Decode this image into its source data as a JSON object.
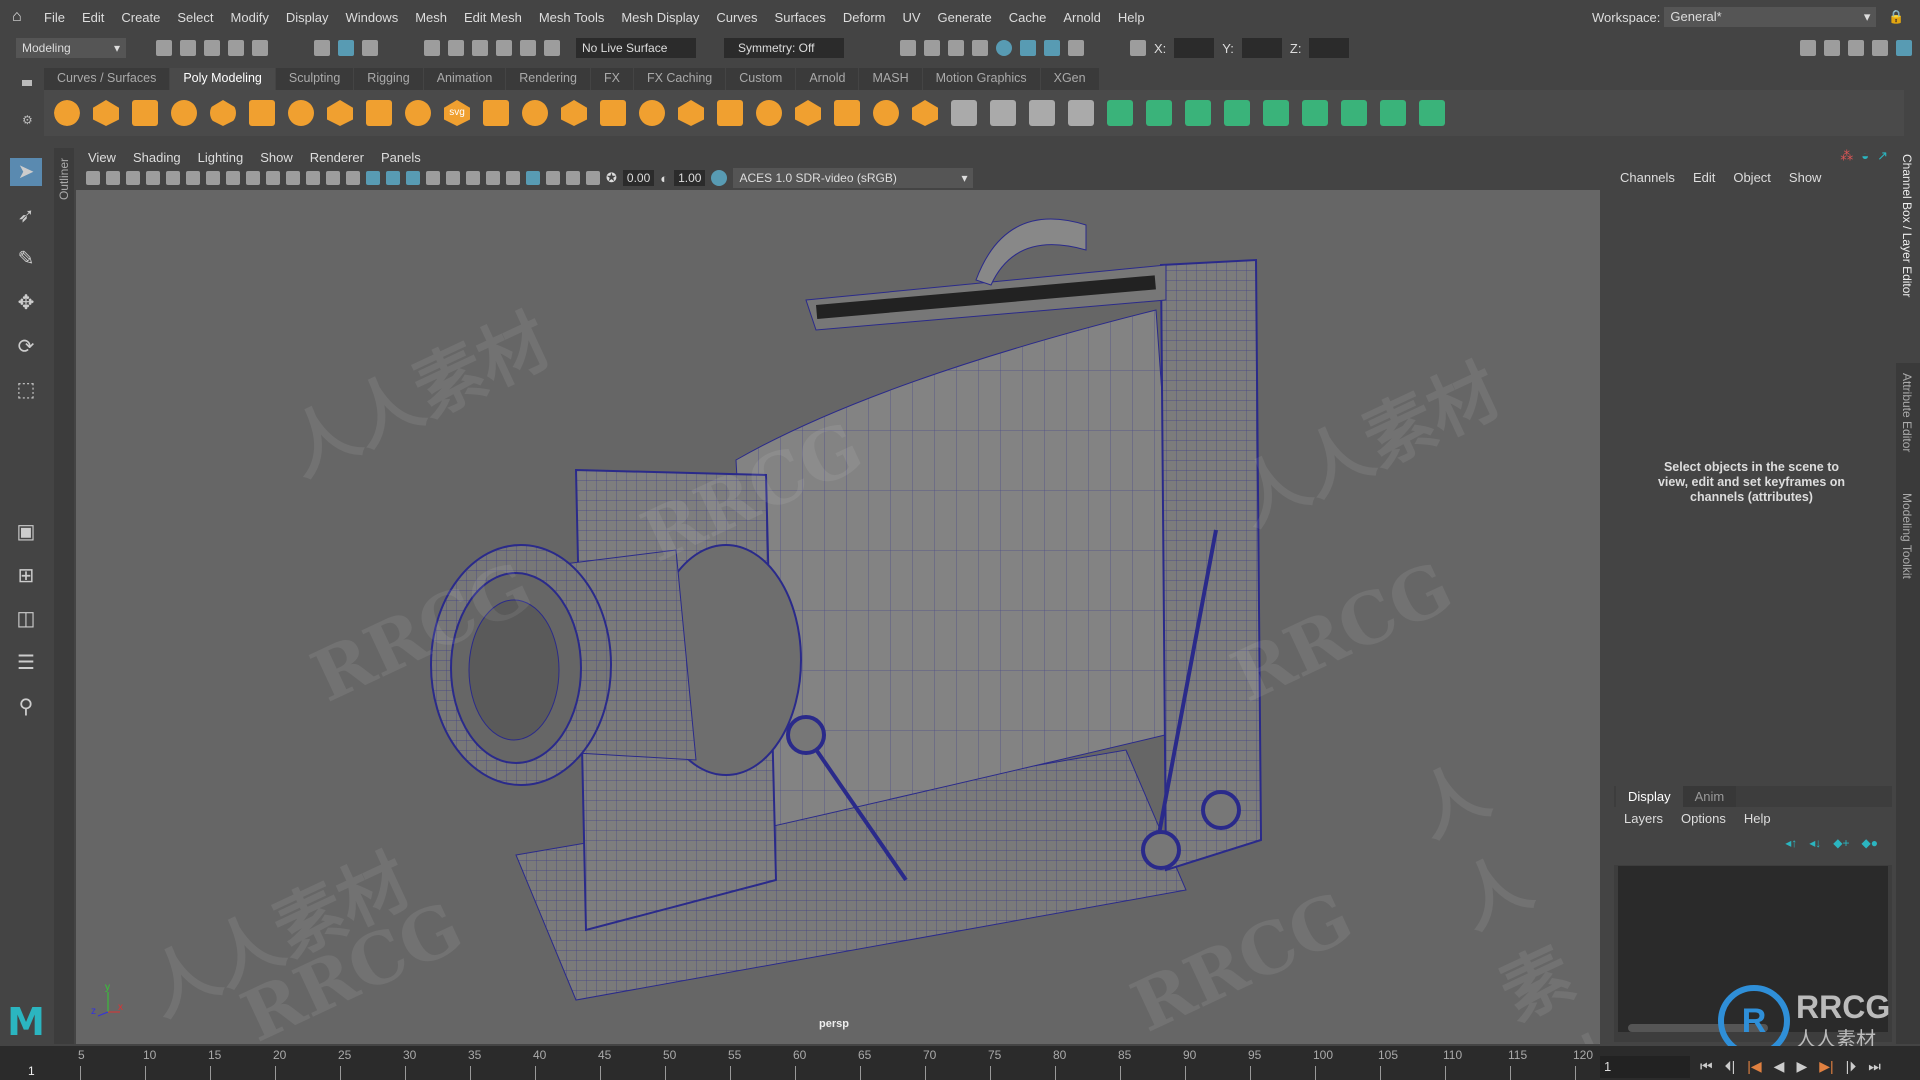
{
  "menu": [
    "File",
    "Edit",
    "Create",
    "Select",
    "Modify",
    "Display",
    "Windows",
    "Mesh",
    "Edit Mesh",
    "Mesh Tools",
    "Mesh Display",
    "Curves",
    "Surfaces",
    "Deform",
    "UV",
    "Generate",
    "Cache",
    "Arnold",
    "Help"
  ],
  "workspace": {
    "label": "Workspace:",
    "value": "General*"
  },
  "status": {
    "mode": "Modeling",
    "live_surface": "No Live Surface",
    "symmetry": "Symmetry: Off",
    "x_label": "X:",
    "y_label": "Y:",
    "z_label": "Z:"
  },
  "shelf_tabs": [
    "Curves / Surfaces",
    "Poly Modeling",
    "Sculpting",
    "Rigging",
    "Animation",
    "Rendering",
    "FX",
    "FX Caching",
    "Custom",
    "Arnold",
    "MASH",
    "Motion Graphics",
    "XGen"
  ],
  "active_shelf": "Poly Modeling",
  "svg_label": "svg",
  "outliner_tab": "Outliner",
  "panel_menu": [
    "View",
    "Shading",
    "Lighting",
    "Show",
    "Renderer",
    "Panels"
  ],
  "viewport": {
    "exposure": "0.00",
    "gamma": "1.00",
    "color_space": "ACES 1.0 SDR-video (sRGB)",
    "camera": "persp",
    "axis": {
      "y": "y",
      "z": "z",
      "x": "x"
    }
  },
  "channel_box": {
    "menu": [
      "Channels",
      "Edit",
      "Object",
      "Show"
    ],
    "message": "Select objects in the scene to view, edit and set keyframes on channels (attributes)"
  },
  "side_tabs": [
    "Channel Box / Layer Editor",
    "Attribute Editor",
    "Modeling Toolkit"
  ],
  "layer_editor": {
    "tabs": [
      "Display",
      "Anim"
    ],
    "menu": [
      "Layers",
      "Options",
      "Help"
    ]
  },
  "timeline": {
    "ticks": [
      "5",
      "10",
      "15",
      "20",
      "25",
      "30",
      "35",
      "40",
      "45",
      "50",
      "55",
      "60",
      "65",
      "70",
      "75",
      "80",
      "85",
      "90",
      "95",
      "100",
      "105",
      "110",
      "115",
      "120"
    ],
    "start": "1",
    "current_frame": "1"
  },
  "watermark": {
    "text": "RRCG",
    "sub": "人人素材"
  },
  "colors": {
    "accent": "#5fb8d8",
    "shelf_orange": "#f0a030",
    "shelf_green": "#3ab37a",
    "wire": "#2a2a8a"
  }
}
